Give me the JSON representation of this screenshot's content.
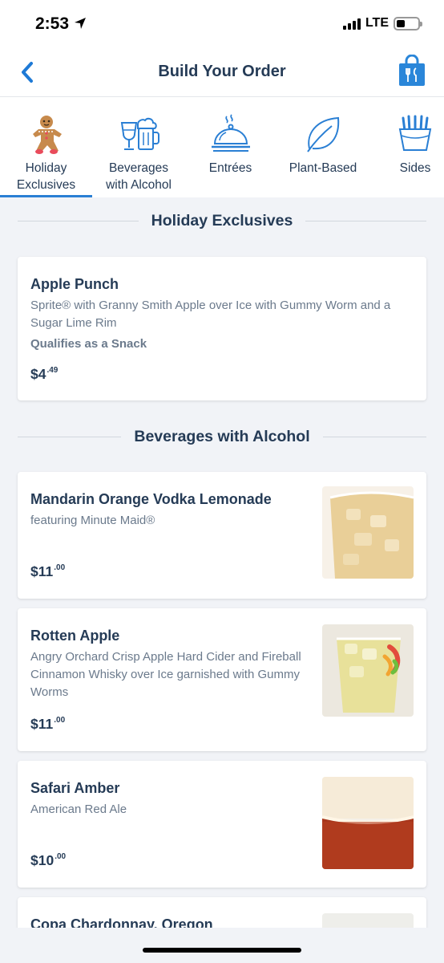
{
  "status_bar": {
    "time": "2:53",
    "carrier": "LTE"
  },
  "nav": {
    "back_icon": "chevron-left-icon",
    "title": "Build Your Order",
    "bag_icon": "shopping-bag-icon"
  },
  "categories": [
    {
      "label_line1": "Holiday",
      "label_line2": "Exclusives",
      "icon": "gingerbread-icon",
      "active": true
    },
    {
      "label_line1": "Beverages",
      "label_line2": "with Alcohol",
      "icon": "wine-beer-icon",
      "active": false
    },
    {
      "label_line1": "Entrées",
      "label_line2": "",
      "icon": "cloche-icon",
      "active": false
    },
    {
      "label_line1": "Plant-Based",
      "label_line2": "",
      "icon": "leaf-icon",
      "active": false
    },
    {
      "label_line1": "Sides",
      "label_line2": "",
      "icon": "fries-icon",
      "active": false
    }
  ],
  "sections": [
    {
      "title": "Holiday Exclusives",
      "items": [
        {
          "name": "Apple Punch",
          "description": "Sprite® with Granny Smith Apple over Ice with Gummy Worm and a Sugar Lime Rim",
          "note": "Qualifies as a Snack",
          "price_dollars": "$4",
          "price_cents": ".49"
        }
      ]
    },
    {
      "title": "Beverages with Alcohol",
      "items": [
        {
          "name": "Mandarin Orange Vodka Lemonade",
          "description": "featuring Minute Maid®",
          "price_dollars": "$11",
          "price_cents": ".00"
        },
        {
          "name": "Rotten Apple",
          "description": "Angry Orchard Crisp Apple Hard Cider and Fireball Cinnamon Whisky over Ice garnished with Gummy Worms",
          "price_dollars": "$11",
          "price_cents": ".00"
        },
        {
          "name": "Safari Amber",
          "description": "American Red Ale",
          "price_dollars": "$10",
          "price_cents": ".00"
        },
        {
          "name": "Copa Chardonnay, Oregon"
        }
      ]
    }
  ],
  "colors": {
    "accent": "#1e7ad6",
    "text_primary": "#253b56",
    "text_secondary": "#6b7a8c",
    "background": "#f1f3f7"
  }
}
